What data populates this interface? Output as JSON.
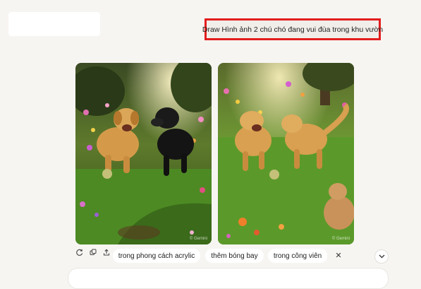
{
  "prompt": {
    "text": "Draw Hình ảnh 2 chú chó đang vui đùa trong khu vườn"
  },
  "images": [
    {
      "icon": "two-dogs-garden-image",
      "watermark": "© Gemini"
    },
    {
      "icon": "three-dogs-garden-image",
      "watermark": "© Gemini"
    }
  ],
  "actions": {
    "icons": [
      "refresh-icon",
      "copy-icon",
      "share-icon"
    ]
  },
  "suggestions": [
    {
      "label": "trong phong cách acrylic"
    },
    {
      "label": "thêm bóng bay"
    },
    {
      "label": "trong công viên"
    }
  ],
  "controls": {
    "close_symbol": "✕",
    "expand_icon": "chevron-down-icon"
  },
  "colors": {
    "highlight_border": "#e21d1d",
    "background": "#f7f5f2"
  }
}
